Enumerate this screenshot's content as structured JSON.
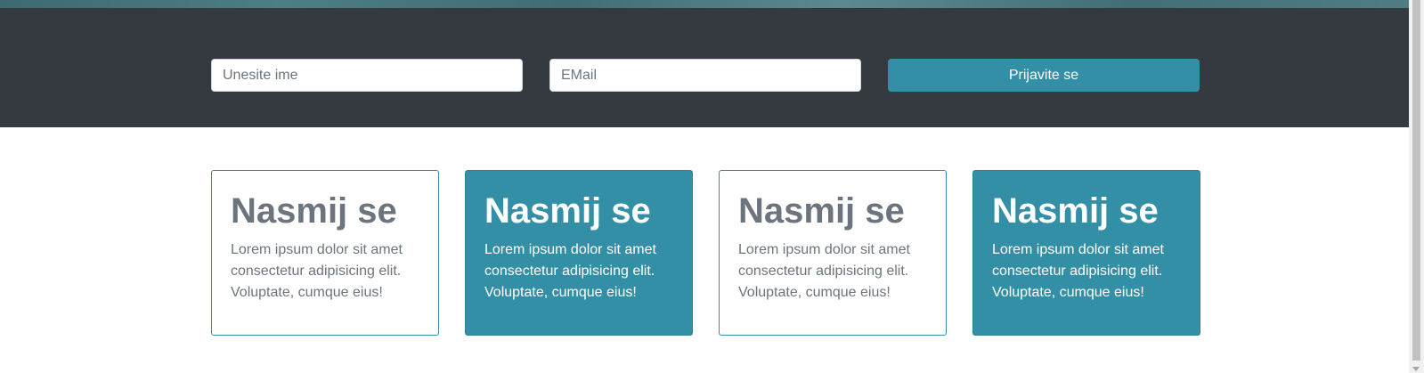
{
  "signup": {
    "name_placeholder": "Unesite ime",
    "email_placeholder": "EMail",
    "submit_label": "Prijavite se"
  },
  "cards": [
    {
      "title": "Nasmij se",
      "text": "Lorem ipsum dolor sit amet consectetur adipisicing elit. Voluptate, cumque eius!",
      "style": "outline"
    },
    {
      "title": "Nasmij se",
      "text": "Lorem ipsum dolor sit amet consectetur adipisicing elit. Voluptate, cumque eius!",
      "style": "filled"
    },
    {
      "title": "Nasmij se",
      "text": "Lorem ipsum dolor sit amet consectetur adipisicing elit. Voluptate, cumque eius!",
      "style": "outline"
    },
    {
      "title": "Nasmij se",
      "text": "Lorem ipsum dolor sit amet consectetur adipisicing elit. Voluptate, cumque eius!",
      "style": "filled"
    }
  ],
  "colors": {
    "accent": "#328fa5",
    "band": "#343a40",
    "muted_text": "#6c757d"
  }
}
